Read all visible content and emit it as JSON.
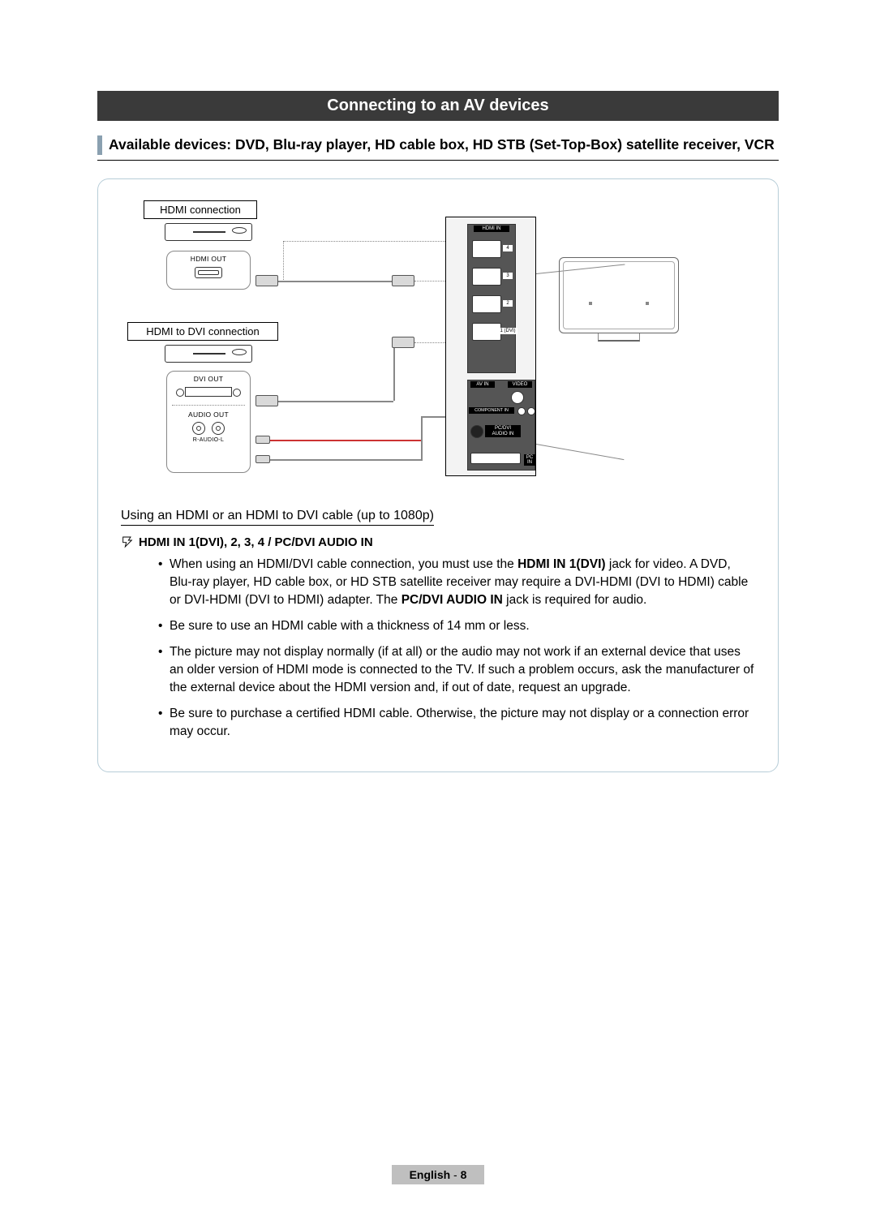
{
  "title": "Connecting to an AV devices",
  "subheading": "Available devices: DVD, Blu-ray player, HD cable box, HD STB (Set-Top-Box) satellite receiver, VCR",
  "diagram": {
    "label_hdmi_connection": "HDMI connection",
    "label_hdmi_to_dvi_connection": "HDMI to DVI connection",
    "label_hdmi_out": "HDMI OUT",
    "label_dvi_out": "DVI OUT",
    "label_audio_out": "AUDIO OUT",
    "label_r_audio_l": "R-AUDIO-L",
    "panel": {
      "hdmi_in": "HDMI IN",
      "port4": "4",
      "port3": "3",
      "port2": "2",
      "port1": "1 (DVI)",
      "av_in": "AV IN",
      "video": "VIDEO",
      "component_in": "COMPONENT IN",
      "pc_dvi_audio_in": "PC/DVI AUDIO IN",
      "pc_in": "PC IN"
    }
  },
  "body": {
    "heading": "Using an HDMI or an HDMI to DVI cable (up to 1080p)",
    "note_line": "HDMI IN 1(DVI), 2, 3, 4 / PC/DVI AUDIO IN",
    "bullet1_pre": "When using an HDMI/DVI cable connection, you must use the ",
    "bullet1_bold1": "HDMI IN 1(DVI)",
    "bullet1_mid": " jack for video. A DVD, Blu-ray player, HD cable box, or HD STB satellite receiver may require a DVI-HDMI (DVI to HDMI) cable or DVI-HDMI (DVI to HDMI) adapter. The ",
    "bullet1_bold2": "PC/DVI AUDIO IN",
    "bullet1_post": " jack is required for audio.",
    "bullet2": "Be sure to use an HDMI cable with a thickness of 14 mm or less.",
    "bullet3": "The picture may not display normally (if at all) or the audio may not work if an external device that uses an older version of HDMI mode is connected to the TV. If such a problem occurs, ask the manufacturer of the external device about the HDMI version and, if out of date, request an upgrade.",
    "bullet4": "Be sure to purchase a certified HDMI cable. Otherwise, the picture may not display or a connection error may occur."
  },
  "footer": {
    "language": "English",
    "sep": " - ",
    "page": "8"
  }
}
